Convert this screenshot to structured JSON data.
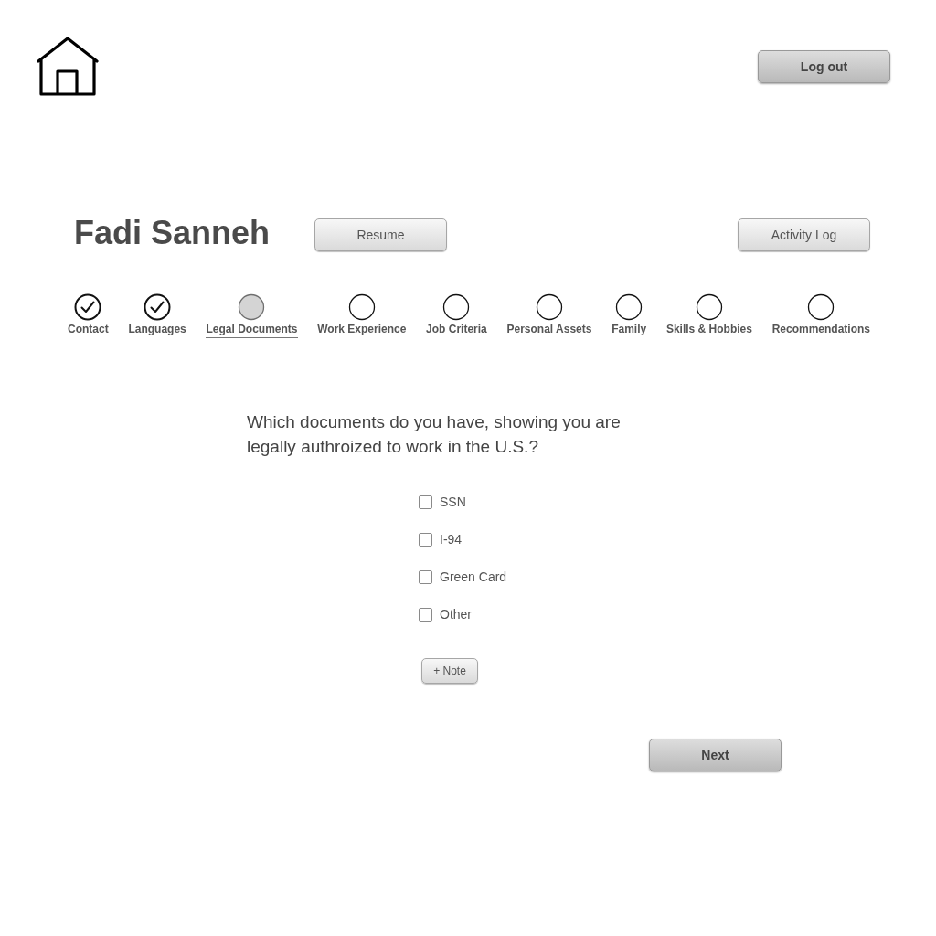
{
  "header": {
    "logout_button": "Log out"
  },
  "profile": {
    "name": "Fadi Sanneh",
    "resume_button": "Resume",
    "activity_log_button": "Activity Log"
  },
  "steps": [
    {
      "label": "Contact",
      "completed": true,
      "selected": false
    },
    {
      "label": "Languages",
      "completed": true,
      "selected": false
    },
    {
      "label": "Legal Documents",
      "completed": false,
      "selected": true
    },
    {
      "label": "Work Experience",
      "completed": false,
      "selected": false
    },
    {
      "label": "Job Criteria",
      "completed": false,
      "selected": false
    },
    {
      "label": "Personal Assets",
      "completed": false,
      "selected": false
    },
    {
      "label": "Family",
      "completed": false,
      "selected": false
    },
    {
      "label": "Skills & Hobbies",
      "completed": false,
      "selected": false
    },
    {
      "label": "Recommendations",
      "completed": false,
      "selected": false
    }
  ],
  "question": {
    "text": "Which documents do you have, showing you are legally authroized to work in the U.S.?",
    "options": [
      {
        "label": "SSN",
        "checked": false
      },
      {
        "label": "I-94",
        "checked": false
      },
      {
        "label": "Green Card",
        "checked": false
      },
      {
        "label": "Other",
        "checked": false
      }
    ],
    "note_button": "+ Note"
  },
  "next_button": "Next"
}
